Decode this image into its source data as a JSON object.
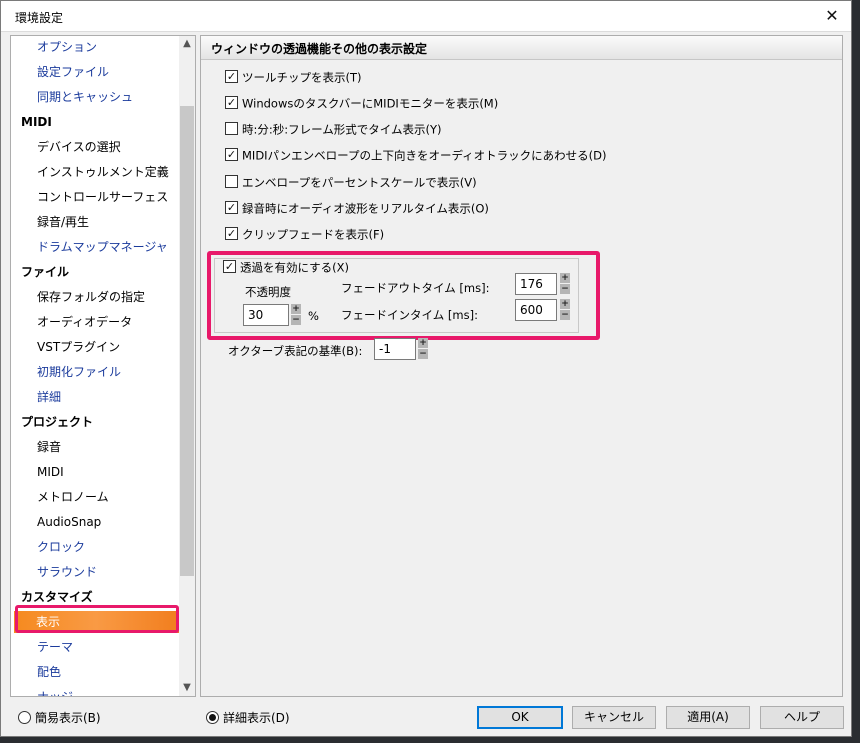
{
  "window": {
    "title": "環境設定",
    "close_glyph": "✕"
  },
  "tree": {
    "items": [
      {
        "label": "オプション",
        "kind": "item",
        "color": "blue"
      },
      {
        "label": "設定ファイル",
        "kind": "item",
        "color": "blue"
      },
      {
        "label": "同期とキャッシュ",
        "kind": "item",
        "color": "blue"
      },
      {
        "label": "MIDI",
        "kind": "cat"
      },
      {
        "label": "デバイスの選択",
        "kind": "item"
      },
      {
        "label": "インストゥルメント定義",
        "kind": "item"
      },
      {
        "label": "コントロールサーフェス",
        "kind": "item"
      },
      {
        "label": "録音/再生",
        "kind": "item"
      },
      {
        "label": "ドラムマップマネージャ",
        "kind": "item",
        "color": "blue"
      },
      {
        "label": "ファイル",
        "kind": "cat"
      },
      {
        "label": "保存フォルダの指定",
        "kind": "item"
      },
      {
        "label": "オーディオデータ",
        "kind": "item"
      },
      {
        "label": "VSTプラグイン",
        "kind": "item"
      },
      {
        "label": "初期化ファイル",
        "kind": "item",
        "color": "blue"
      },
      {
        "label": "詳細",
        "kind": "item",
        "color": "blue"
      },
      {
        "label": "プロジェクト",
        "kind": "cat"
      },
      {
        "label": "録音",
        "kind": "item"
      },
      {
        "label": "MIDI",
        "kind": "item"
      },
      {
        "label": "メトロノーム",
        "kind": "item"
      },
      {
        "label": "AudioSnap",
        "kind": "item"
      },
      {
        "label": "クロック",
        "kind": "item",
        "color": "blue"
      },
      {
        "label": "サラウンド",
        "kind": "item",
        "color": "blue"
      },
      {
        "label": "カスタマイズ",
        "kind": "cat"
      },
      {
        "label": "表示",
        "kind": "item",
        "selected": true
      },
      {
        "label": "テーマ",
        "kind": "item",
        "color": "blue"
      },
      {
        "label": "配色",
        "kind": "item",
        "color": "blue"
      },
      {
        "label": "ナッジ",
        "kind": "item",
        "color": "blue"
      }
    ],
    "scroll_up": "▲",
    "scroll_down": "▼"
  },
  "panel": {
    "title": "ウィンドウの透過機能その他の表示設定",
    "checkboxes": [
      {
        "label": "ツールチップを表示(T)",
        "checked": true
      },
      {
        "label": "WindowsのタスクバーにMIDIモニターを表示(M)",
        "checked": true
      },
      {
        "label": "時:分:秒:フレーム形式でタイム表示(Y)",
        "checked": false
      },
      {
        "label": "MIDIパンエンベロープの上下向きをオーディオトラックにあわせる(D)",
        "checked": true
      },
      {
        "label": "エンベロープをパーセントスケールで表示(V)",
        "checked": false
      },
      {
        "label": "録音時にオーディオ波形をリアルタイム表示(O)",
        "checked": true
      },
      {
        "label": "クリップフェードを表示(F)",
        "checked": true
      }
    ],
    "transparency": {
      "enable_label": "透過を有効にする(X)",
      "enable_checked": true,
      "opacity_label": "不透明度",
      "opacity_value": "30",
      "opacity_unit": "%",
      "fadeout_label": "フェードアウトタイム [ms]:",
      "fadeout_value": "176",
      "fadein_label": "フェードインタイム [ms]:",
      "fadein_value": "600"
    },
    "octave": {
      "label": "オクターブ表記の基準(B):",
      "value": "-1"
    }
  },
  "footer": {
    "simple_view": "簡易表示(B)",
    "detail_view": "詳細表示(D)",
    "ok": "OK",
    "cancel": "キャンセル",
    "apply": "適用(A)",
    "help": "ヘルプ"
  },
  "colors": {
    "highlight": "#e8196a",
    "selected_bg": "#f58a1f",
    "link_blue": "#1b3b9c"
  }
}
